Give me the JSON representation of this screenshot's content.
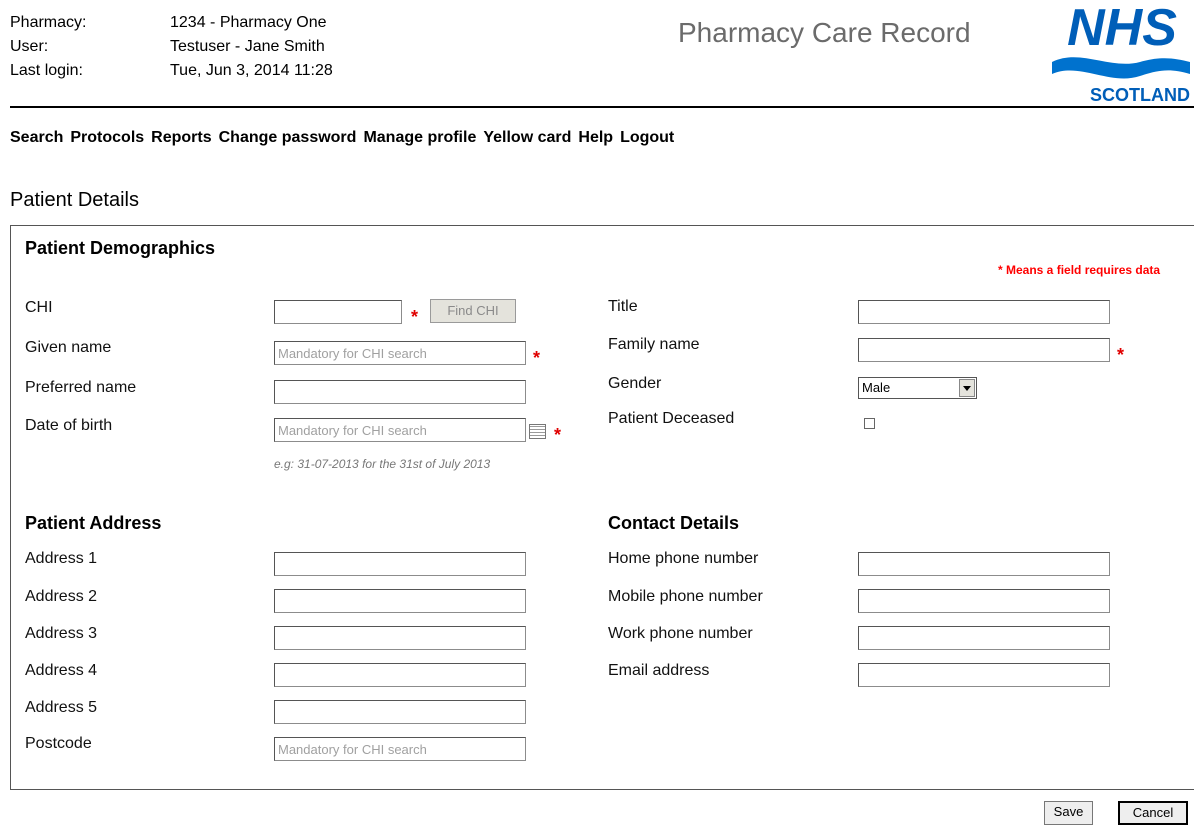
{
  "header": {
    "pharmacy_label": "Pharmacy:",
    "pharmacy_value": "1234 - Pharmacy One",
    "user_label": "User:",
    "user_value": "Testuser - Jane Smith",
    "lastlogin_label": "Last login:",
    "lastlogin_value": "Tue, Jun 3, 2014 11:28",
    "app_title": "Pharmacy Care Record",
    "logo_text": "NHS",
    "logo_subtext": "SCOTLAND",
    "logo_color": "#005eb8"
  },
  "nav": [
    "Search",
    "Protocols",
    "Reports",
    "Change password",
    "Manage profile",
    "Yellow card",
    "Help",
    "Logout"
  ],
  "page_title": "Patient Details",
  "demographics": {
    "heading": "Patient Demographics",
    "required_note": "* Means a field requires data",
    "chi_label": "CHI",
    "find_chi": "Find CHI",
    "given_name_label": "Given name",
    "given_name_placeholder": "Mandatory for CHI search",
    "preferred_name_label": "Preferred name",
    "dob_label": "Date of birth",
    "dob_placeholder": "Mandatory for CHI search",
    "dob_hint": "e.g: 31-07-2013 for the 31st of July 2013",
    "title_label": "Title",
    "family_name_label": "Family name",
    "gender_label": "Gender",
    "gender_value": "Male",
    "deceased_label": "Patient Deceased",
    "required_mark": "*"
  },
  "address": {
    "heading": "Patient Address",
    "address1_label": "Address 1",
    "address2_label": "Address 2",
    "address3_label": "Address 3",
    "address4_label": "Address 4",
    "address5_label": "Address 5",
    "postcode_label": "Postcode",
    "postcode_placeholder": "Mandatory for CHI search"
  },
  "contact": {
    "heading": "Contact Details",
    "home_phone_label": "Home phone number",
    "mobile_phone_label": "Mobile phone number",
    "work_phone_label": "Work phone number",
    "email_label": "Email address"
  },
  "actions": {
    "save": "Save",
    "cancel": "Cancel"
  }
}
